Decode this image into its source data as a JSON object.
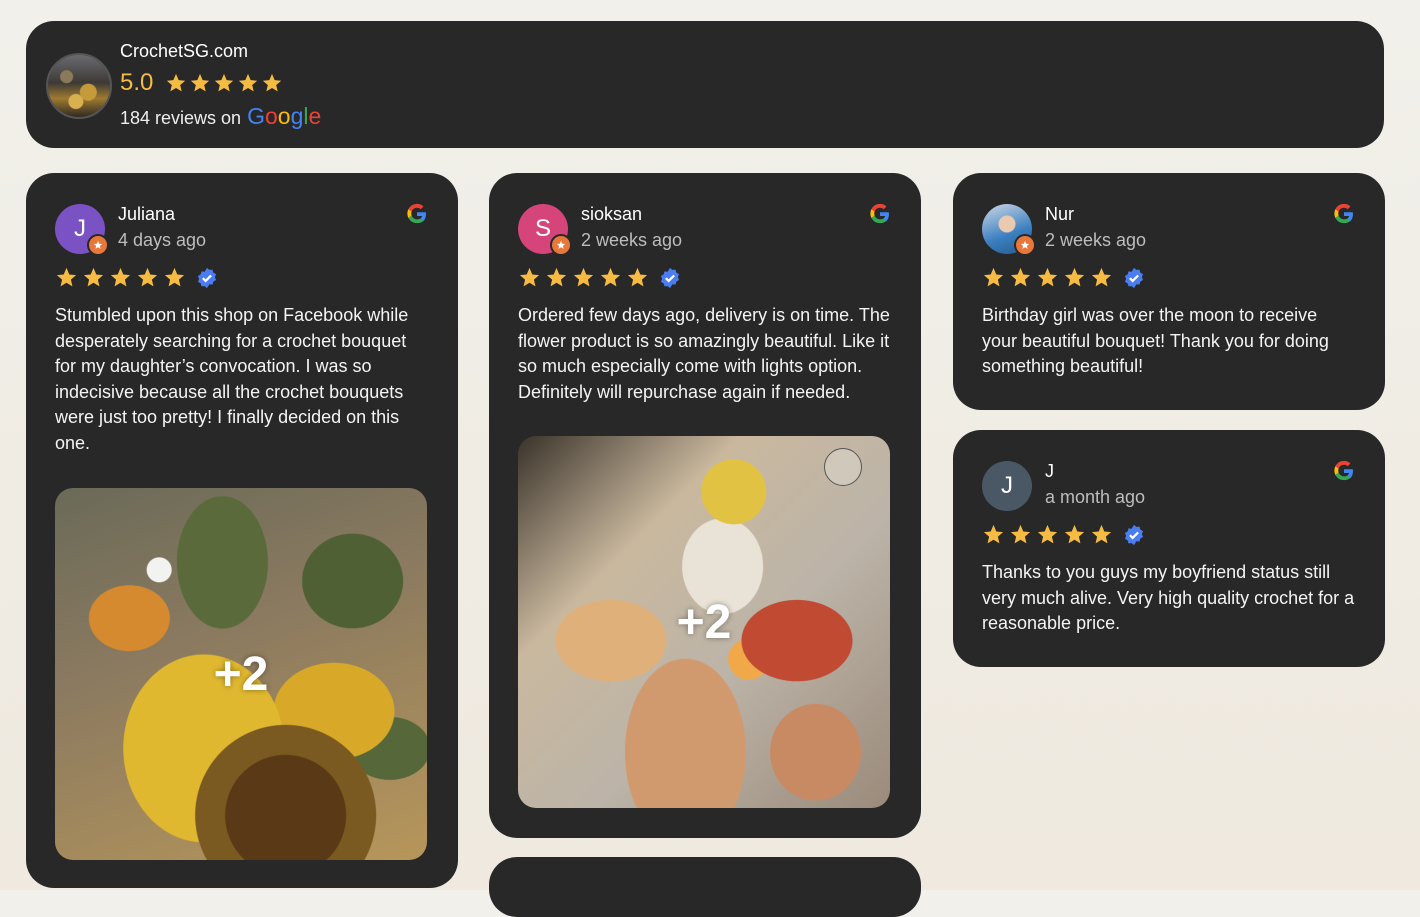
{
  "business": {
    "name": "CrochetSG.com",
    "rating": "5.0",
    "stars": 5,
    "reviews_prefix": "184 reviews on",
    "google_wordmark": [
      "G",
      "o",
      "o",
      "g",
      "l",
      "e"
    ]
  },
  "reviews": [
    {
      "name": "Juliana",
      "time": "4 days ago",
      "initial": "J",
      "avatar_color": "#7b52c4",
      "stars": 5,
      "text": "Stumbled upon this shop on Facebook while desperately searching for a crochet bouquet for my daughter’s convocation. I was so indecisive because all the crochet bouquets were just too pretty! I finally decided on this one.",
      "more_photos": "+2"
    },
    {
      "name": "sioksan",
      "time": "2 weeks ago",
      "initial": "S",
      "avatar_color": "#d6457a",
      "stars": 5,
      "text": "Ordered few days ago, delivery is on time. The flower product is so amazingly beautiful. Like it so much especially come with lights option. Definitely will repurchase again if needed.",
      "more_photos": "+2"
    },
    {
      "name": "Nur",
      "time": "2 weeks ago",
      "initial": "",
      "avatar_color": "#6a8ab0",
      "stars": 5,
      "text": "Birthday girl was over the moon to receive your beautiful bouquet! Thank you for doing something beautiful!"
    },
    {
      "name": "J",
      "time": "a month ago",
      "initial": "J",
      "avatar_color": "#4a5866",
      "stars": 5,
      "text": "Thanks to you guys my boyfriend status still very much alive. Very high quality crochet for a reasonable price."
    }
  ],
  "colors": {
    "card": "#282828",
    "star": "#f6bb42",
    "verified": "#4a7df0"
  }
}
